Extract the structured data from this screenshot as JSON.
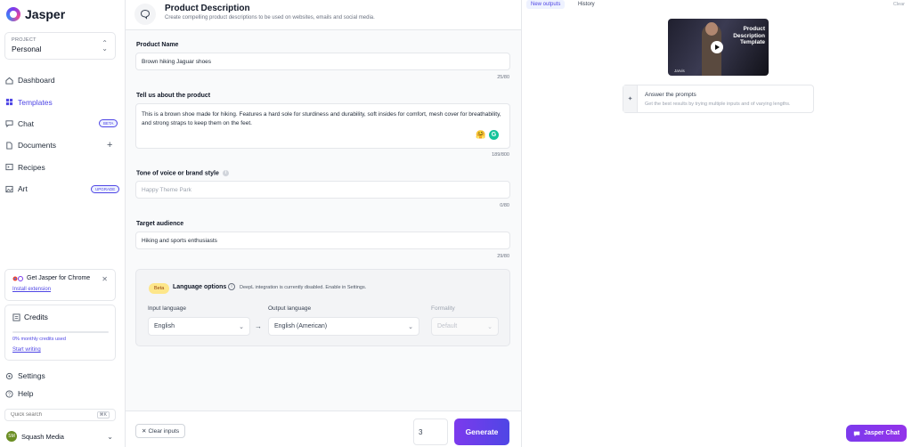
{
  "app": {
    "name": "Jasper"
  },
  "project": {
    "label": "PROJECT",
    "name": "Personal"
  },
  "sidebar": {
    "items": [
      {
        "label": "Dashboard",
        "icon": "home-icon"
      },
      {
        "label": "Templates",
        "icon": "grid-icon",
        "active": true
      },
      {
        "label": "Chat",
        "icon": "chat-icon",
        "badge": "BETA"
      },
      {
        "label": "Documents",
        "icon": "document-icon"
      },
      {
        "label": "Recipes",
        "icon": "terminal-icon"
      },
      {
        "label": "Art",
        "icon": "image-icon",
        "badge": "UPGRADE"
      }
    ],
    "chrome": {
      "title": "Get Jasper for Chrome",
      "link": "Install extension"
    },
    "credits": {
      "title": "Credits",
      "used_text": "0% monthly credits used",
      "used_fraction": 0.0,
      "link": "Start writing"
    },
    "bottom": [
      {
        "label": "Settings",
        "icon": "gear-icon"
      },
      {
        "label": "Help",
        "icon": "help-icon"
      }
    ],
    "search": {
      "placeholder": "Quick search",
      "shortcut": "⌘K"
    },
    "workspace": {
      "initials": "SM",
      "name": "Squash Media"
    }
  },
  "form": {
    "title": "Product Description",
    "subtitle": "Create compelling product descriptions to be used on websites, emails and social media.",
    "product_name": {
      "label": "Product Name",
      "value": "Brown hiking Jaguar shoes",
      "counter": "25/80"
    },
    "about": {
      "label": "Tell us about the product",
      "value": "This is a brown shoe made for hiking. Features a hard sole for sturdiness and durability, soft insides for comfort, mesh cover for breathability, and strong straps to keep them on the feet.",
      "counter": "189/800"
    },
    "tone": {
      "label": "Tone of voice or brand style",
      "placeholder": "Happy Theme Park",
      "counter": "0/80"
    },
    "audience": {
      "label": "Target audience",
      "value": "Hiking and sports enthusiasts",
      "counter": "29/80"
    },
    "language": {
      "beta": "Beta",
      "title": "Language options",
      "note": "DeepL integration is currently disabled. Enable in Settings.",
      "input_label": "Input language",
      "input_value": "English",
      "output_label": "Output language",
      "output_value": "English (American)",
      "formality_label": "Formality",
      "formality_value": "Default"
    },
    "footer": {
      "clear": "Clear inputs",
      "count": "3",
      "generate": "Generate"
    }
  },
  "output": {
    "tabs": [
      "New outputs",
      "History"
    ],
    "clear": "Clear",
    "video": {
      "title": "Product Description Template",
      "brand": "Jarvis"
    },
    "prompt": {
      "title": "Answer the prompts",
      "subtitle": "Get the best results by trying multiple inputs and of varying lengths."
    },
    "chat_button": "Jasper Chat"
  },
  "colors": {
    "accent": "#4f46e5",
    "brand": "#7c3aed",
    "beta": "#fde68a"
  }
}
